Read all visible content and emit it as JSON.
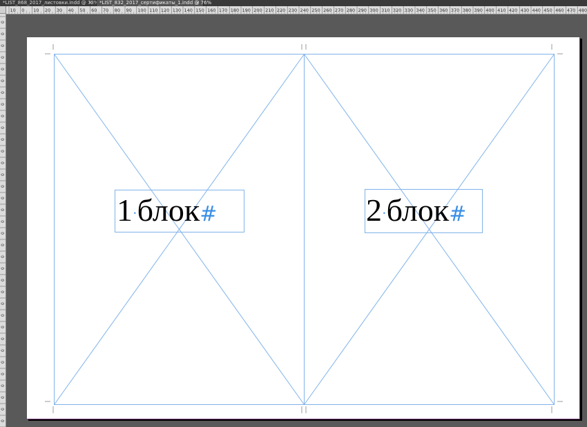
{
  "window": {
    "tabs": [
      {
        "label": "*LIST_868_2017_листовки.indd @ 73%",
        "close": "×",
        "active": false
      },
      {
        "label": "*LIST_832_2017_сертификаты_1.indd @ 76%",
        "close": "×",
        "active": true
      }
    ]
  },
  "ruler": {
    "horizontal_ticks": [
      "10",
      "0",
      "10",
      "20",
      "30",
      "40",
      "50",
      "60",
      "70",
      "80",
      "90",
      "100",
      "110",
      "120",
      "130",
      "140",
      "150",
      "160",
      "170",
      "180",
      "190",
      "200",
      "210",
      "220",
      "230",
      "240",
      "250",
      "260",
      "270",
      "280",
      "290",
      "300",
      "310",
      "320",
      "330",
      "340",
      "350",
      "360",
      "370",
      "380",
      "390",
      "400",
      "410",
      "420",
      "430",
      "440",
      "450",
      "460",
      "470",
      "480"
    ],
    "vertical_label": "0"
  },
  "document": {
    "text_frames": [
      {
        "number": "1",
        "dot": "·",
        "word": "блок",
        "hash": "#"
      },
      {
        "number": "2",
        "dot": "·",
        "word": "блок",
        "hash": "#"
      }
    ]
  },
  "colors": {
    "frame_guides": "#7fb2ea",
    "page_bg": "#ffffff",
    "pasteboard": "#595959"
  }
}
